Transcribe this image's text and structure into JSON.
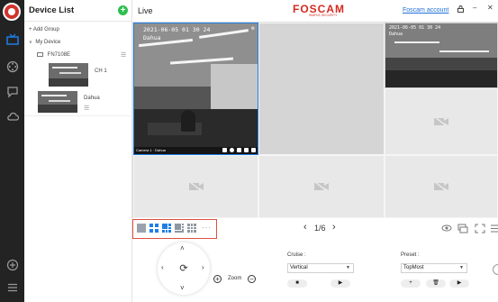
{
  "sidebar": {
    "device_list_title": "Device List"
  },
  "devices": {
    "add_group": "+ Add Group",
    "my_device": "My Device",
    "nvr_name": "FN7108E",
    "channel_label": "CH 1",
    "camera_name": "Dahua"
  },
  "header": {
    "live_label": "Live",
    "brand": "FOSCAM",
    "brand_tagline": "SIMPLE SECURITY",
    "account_link": "Foscam account"
  },
  "main_video": {
    "timestamp": "2021-06-05 01 30 24",
    "camera_osd_name": "Dahua",
    "footer_label": "Camera 1 · Dahua"
  },
  "sub_video": {
    "timestamp": "2021-06-05 01 30 24",
    "camera_osd_name": "Dahua"
  },
  "toolbar": {
    "more_layouts": "···",
    "page_indicator": "1/6"
  },
  "ptz": {
    "zoom_label": "Zoom",
    "cruise_label": "Cruise :",
    "cruise_value": "Vertical",
    "preset_label": "Preset :",
    "preset_value": "TopMost"
  },
  "colors": {
    "accent": "#1e7ee8",
    "brand": "#d42a20",
    "selection_frame": "#e0503e"
  }
}
